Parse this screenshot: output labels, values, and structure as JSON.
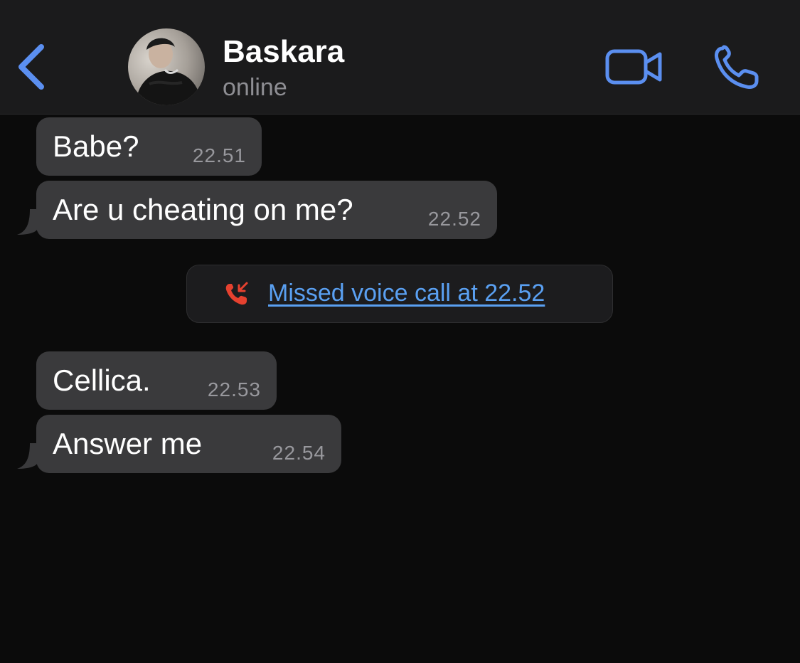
{
  "colors": {
    "accent": "#5b8ff0",
    "bubble": "#3a3a3c",
    "header_bg": "#1b1b1c",
    "chat_bg": "#0b0b0b",
    "missed_call": "#e5412f",
    "link": "#5aa0f2"
  },
  "header": {
    "back_icon": "chevron-left-icon",
    "contact_name": "Baskara",
    "status": "online",
    "video_icon": "video-camera-icon",
    "phone_icon": "phone-icon"
  },
  "messages": [
    {
      "text": "Babe?",
      "time": "22.51"
    },
    {
      "text": "Are u cheating on me?",
      "time": "22.52"
    },
    {
      "text": "Cellica.",
      "time": "22.53"
    },
    {
      "text": "Answer me",
      "time": "22.54"
    }
  ],
  "missed_call": {
    "icon": "missed-call-icon",
    "label": "Missed voice call at 22.52"
  }
}
